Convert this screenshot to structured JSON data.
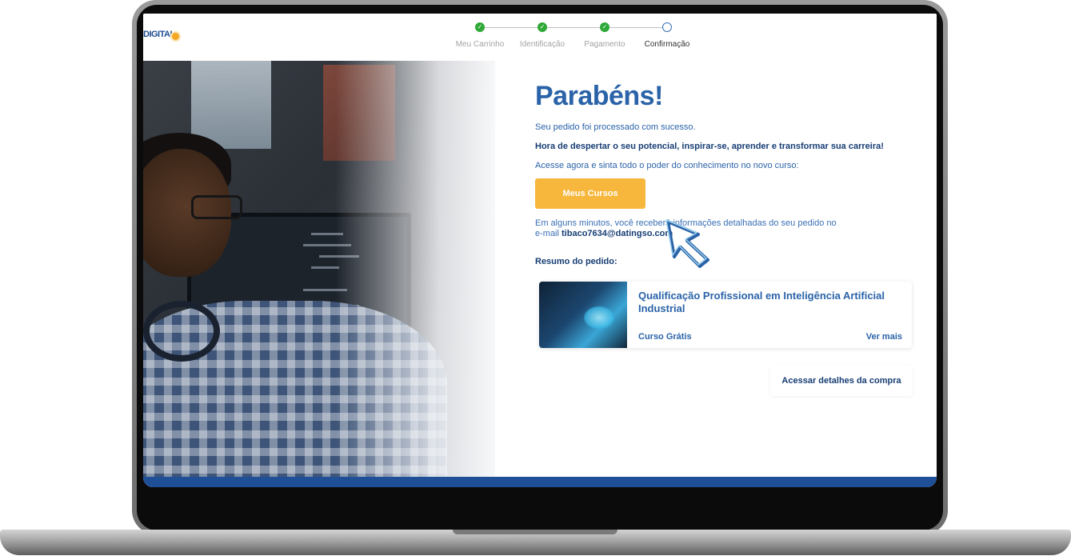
{
  "header": {
    "logo_text": "DIGITAL",
    "steps": [
      {
        "label": "Meu Carrinho",
        "status": "done"
      },
      {
        "label": "Identificação",
        "status": "done"
      },
      {
        "label": "Pagamento",
        "status": "done"
      },
      {
        "label": "Confirmação",
        "status": "current"
      }
    ]
  },
  "main": {
    "title": "Parabéns!",
    "success_text": "Seu pedido foi processado com sucesso.",
    "motto": "Hora de despertar o seu potencial, inspirar-se, aprender e transformar sua carreira!",
    "access_text": "Acesse agora e sinta todo o poder do conhecimento no novo curso:",
    "cta_label": "Meus Cursos",
    "info_line1": "Em alguns minutos, você receberá informações detalhadas do seu pedido no",
    "info_line2_prefix": "e-mail ",
    "email": "tibaco7634@datingso.com",
    "summary_label": "Resumo do pedido:",
    "order": {
      "course_title": "Qualificação Profissional em Inteligência Artificial Industrial",
      "tag": "Curso Grátis",
      "more_label": "Ver mais"
    },
    "details_link": "Acessar detalhes da compra"
  },
  "colors": {
    "primary": "#2a63a8",
    "accent": "#f6b73c",
    "success": "#2ea836",
    "footer": "#1f4f97"
  }
}
